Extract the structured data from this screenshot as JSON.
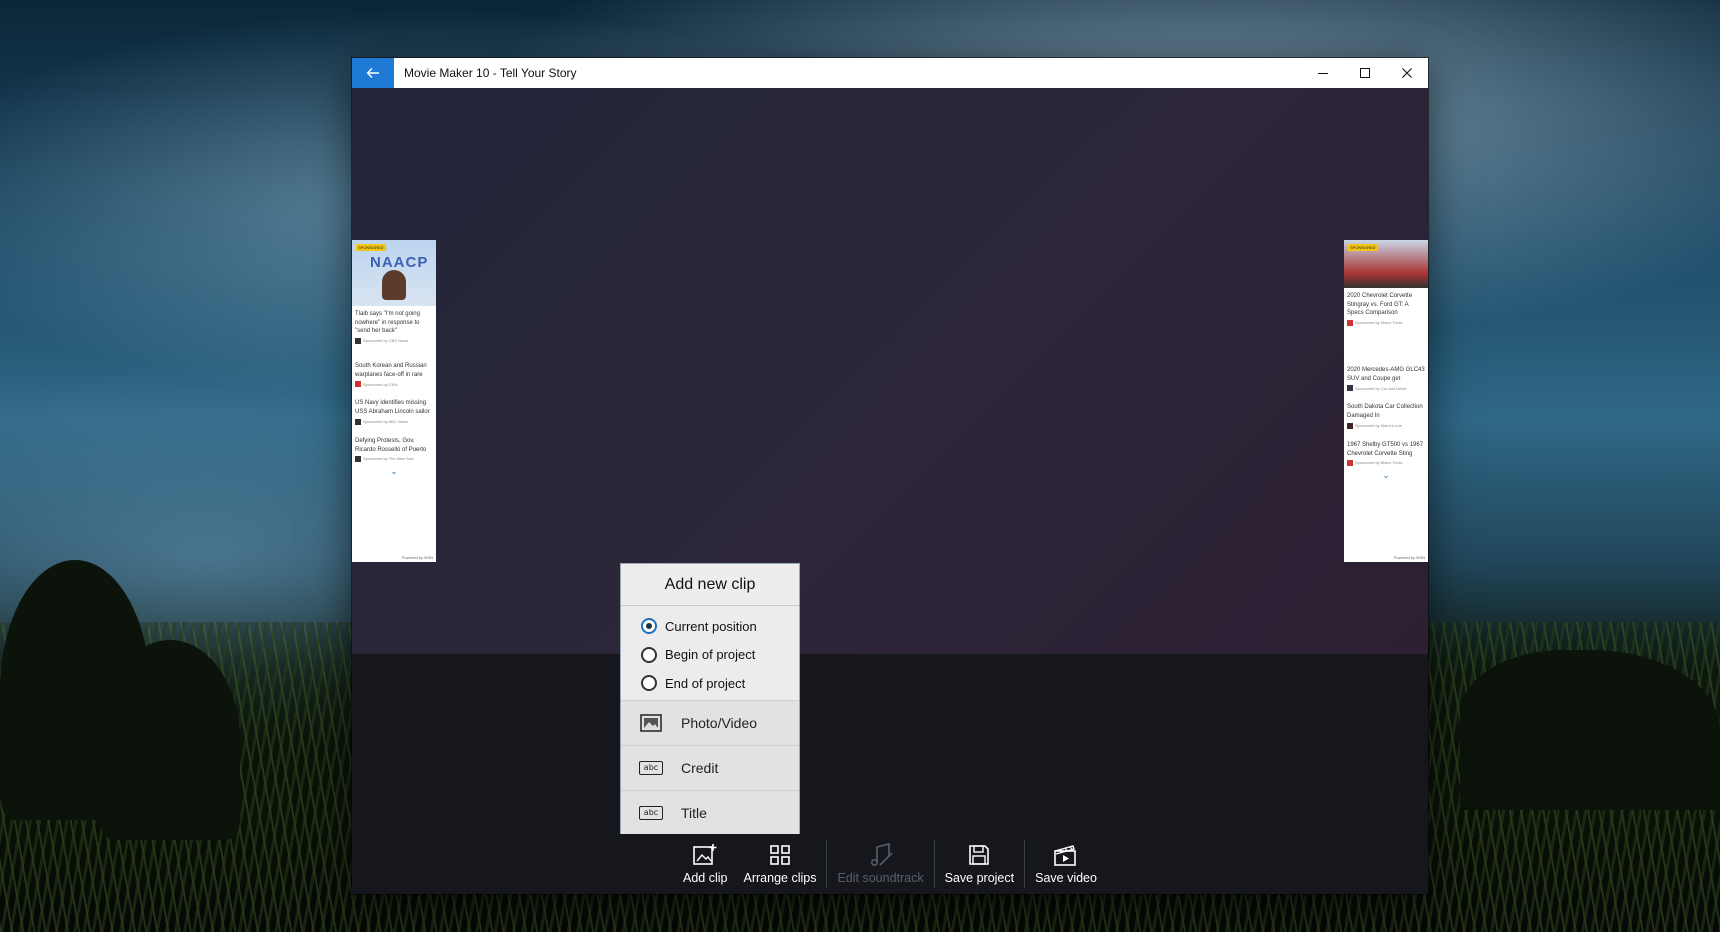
{
  "window": {
    "title": "Movie Maker 10 - Tell Your Story",
    "controls": [
      "minimize-icon",
      "maximize-icon",
      "close-icon"
    ],
    "accent_color": "#1f7ad6"
  },
  "ads": {
    "left": {
      "badge": "SPONSORED",
      "logo_text": "NAACP",
      "items": [
        {
          "headline": "Tlaib says \"I'm not going nowhere\" in response to \"send her back\"",
          "source": "Sponsored by CBS News"
        },
        {
          "headline": "South Korean and Russian warplanes face-off in rare",
          "source": "Sponsored by CNN"
        },
        {
          "headline": "US Navy identifies missing USS Abraham Lincoln sailor",
          "source": "Sponsored by ABC News"
        },
        {
          "headline": "Defying Protests, Gov. Ricardo Rosselló of Puerto",
          "source": "Sponsored by The New York"
        }
      ],
      "footer": "Powered by MSN"
    },
    "right": {
      "badge": "SPONSORED",
      "items": [
        {
          "headline": "2020 Chevrolet Corvette Stingray vs. Ford GT: A Specs Comparison",
          "source": "Sponsored by Motor Trend"
        },
        {
          "headline": "2020 Mercedes-AMG GLC43 SUV and Coupe get",
          "source": "Sponsored by Car and Driver"
        },
        {
          "headline": "South Dakota Car Collection Damaged In",
          "source": "Sponsored by Motor1.com"
        },
        {
          "headline": "1967 Shelby GT500 vs 1967 Chevrolet Corvette Sting",
          "source": "Sponsored by Motor Trend"
        }
      ],
      "footer": "Powered by MSN"
    }
  },
  "add_clip_flyout": {
    "title": "Add new clip",
    "positions": [
      {
        "label": "Current position",
        "selected": true
      },
      {
        "label": "Begin of project",
        "selected": false
      },
      {
        "label": "End of project",
        "selected": false
      }
    ],
    "actions": [
      {
        "label": "Photo/Video",
        "icon": "photo-icon"
      },
      {
        "label": "Credit",
        "icon": "abc-icon",
        "icon_text": "abc"
      },
      {
        "label": "Title",
        "icon": "abc-icon",
        "icon_text": "abc"
      }
    ]
  },
  "toolbar": {
    "add_clip": "Add clip",
    "arrange_clips": "Arrange clips",
    "edit_soundtrack": "Edit soundtrack",
    "save_project": "Save project",
    "save_video": "Save video"
  }
}
